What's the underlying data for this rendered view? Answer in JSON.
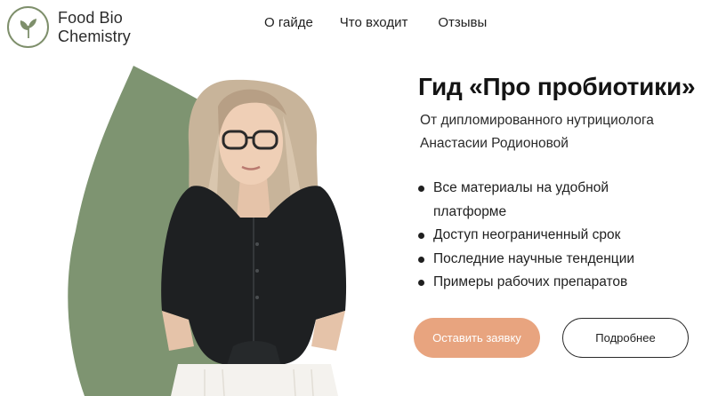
{
  "brand": {
    "line1": "Food Bio",
    "line2": "Chemistry",
    "accent": "#7e8f6b"
  },
  "nav": {
    "items": [
      "О гайде",
      "Что входит",
      "Отзывы"
    ]
  },
  "hero": {
    "title": "Гид «Про пробиотики»",
    "subtitle": "От дипломированного нутрициолога Анастасии Родионовой",
    "features": [
      "Все материалы на удобной платформе",
      "Доступ неограниченный срок",
      "Последние научные тенденции",
      "Примеры рабочих препаратов"
    ],
    "primary_button": "Оставить заявку",
    "secondary_button": "Подробнее",
    "shape_color": "#7e9471",
    "primary_color": "#e8a47f"
  }
}
